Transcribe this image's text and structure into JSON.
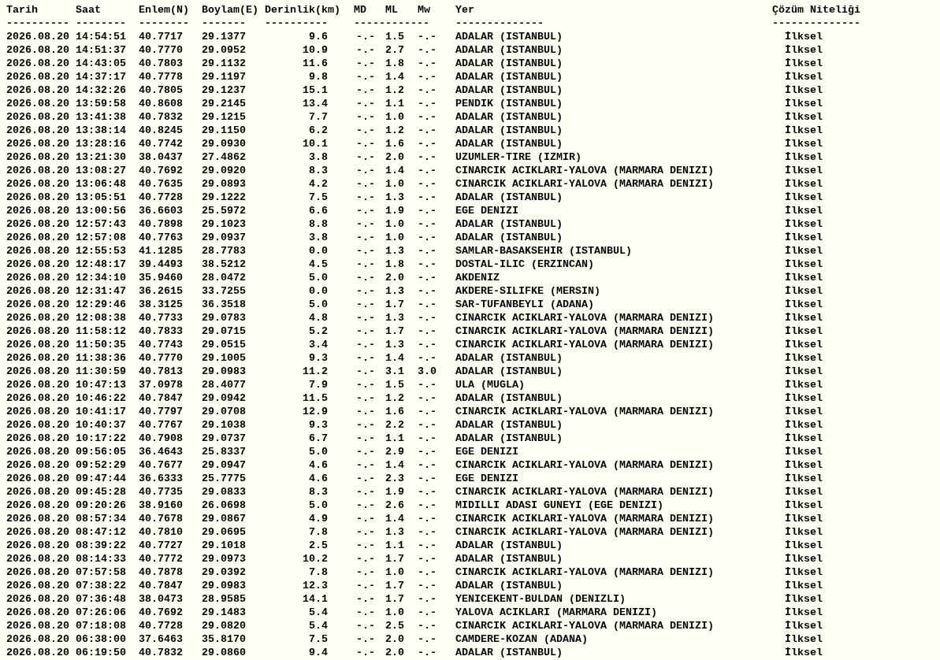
{
  "table": {
    "columns": [
      "Tarih",
      "Saat",
      "Enlem(N)",
      "Boylam(E)",
      "Derinlik(km)",
      "MD",
      "ML",
      "Mw",
      "Yer",
      "Çözüm Niteliği"
    ],
    "separators": [
      "----------",
      "--------",
      "--------",
      "-------",
      "----------",
      "------------",
      "--------------",
      "--------------"
    ],
    "rows": [
      {
        "date": "2026.08.20",
        "time": "14:54:51",
        "lat": "40.7717",
        "lon": "29.1377",
        "depth": "9.6",
        "md": "-.-",
        "ml": "1.5",
        "mw": "-.-",
        "place": "ADALAR (ISTANBUL)",
        "quality": "İlksel"
      },
      {
        "date": "2026.08.20",
        "time": "14:51:37",
        "lat": "40.7770",
        "lon": "29.0952",
        "depth": "10.9",
        "md": "-.-",
        "ml": "2.7",
        "mw": "-.-",
        "place": "ADALAR (ISTANBUL)",
        "quality": "İlksel"
      },
      {
        "date": "2026.08.20",
        "time": "14:43:05",
        "lat": "40.7803",
        "lon": "29.1132",
        "depth": "11.6",
        "md": "-.-",
        "ml": "1.8",
        "mw": "-.-",
        "place": "ADALAR (ISTANBUL)",
        "quality": "İlksel"
      },
      {
        "date": "2026.08.20",
        "time": "14:37:17",
        "lat": "40.7778",
        "lon": "29.1197",
        "depth": "9.8",
        "md": "-.-",
        "ml": "1.4",
        "mw": "-.-",
        "place": "ADALAR (ISTANBUL)",
        "quality": "İlksel"
      },
      {
        "date": "2026.08.20",
        "time": "14:32:26",
        "lat": "40.7805",
        "lon": "29.1237",
        "depth": "15.1",
        "md": "-.-",
        "ml": "1.2",
        "mw": "-.-",
        "place": "ADALAR (ISTANBUL)",
        "quality": "İlksel"
      },
      {
        "date": "2026.08.20",
        "time": "13:59:58",
        "lat": "40.8608",
        "lon": "29.2145",
        "depth": "13.4",
        "md": "-.-",
        "ml": "1.1",
        "mw": "-.-",
        "place": "PENDIK (ISTANBUL)",
        "quality": "İlksel"
      },
      {
        "date": "2026.08.20",
        "time": "13:41:38",
        "lat": "40.7832",
        "lon": "29.1215",
        "depth": "7.7",
        "md": "-.-",
        "ml": "1.0",
        "mw": "-.-",
        "place": "ADALAR (ISTANBUL)",
        "quality": "İlksel"
      },
      {
        "date": "2026.08.20",
        "time": "13:38:14",
        "lat": "40.8245",
        "lon": "29.1150",
        "depth": "6.2",
        "md": "-.-",
        "ml": "1.2",
        "mw": "-.-",
        "place": "ADALAR (ISTANBUL)",
        "quality": "İlksel"
      },
      {
        "date": "2026.08.20",
        "time": "13:28:16",
        "lat": "40.7742",
        "lon": "29.0930",
        "depth": "10.1",
        "md": "-.-",
        "ml": "1.6",
        "mw": "-.-",
        "place": "ADALAR (ISTANBUL)",
        "quality": "İlksel"
      },
      {
        "date": "2026.08.20",
        "time": "13:21:30",
        "lat": "38.0437",
        "lon": "27.4862",
        "depth": "3.8",
        "md": "-.-",
        "ml": "2.0",
        "mw": "-.-",
        "place": "UZUMLER-TIRE (IZMIR)",
        "quality": "İlksel"
      },
      {
        "date": "2026.08.20",
        "time": "13:08:27",
        "lat": "40.7692",
        "lon": "29.0920",
        "depth": "8.3",
        "md": "-.-",
        "ml": "1.4",
        "mw": "-.-",
        "place": "CINARCIK ACIKLARI-YALOVA (MARMARA DENIZI)",
        "quality": "İlksel"
      },
      {
        "date": "2026.08.20",
        "time": "13:06:48",
        "lat": "40.7635",
        "lon": "29.0893",
        "depth": "4.2",
        "md": "-.-",
        "ml": "1.0",
        "mw": "-.-",
        "place": "CINARCIK ACIKLARI-YALOVA (MARMARA DENIZI)",
        "quality": "İlksel"
      },
      {
        "date": "2026.08.20",
        "time": "13:05:51",
        "lat": "40.7728",
        "lon": "29.1222",
        "depth": "7.5",
        "md": "-.-",
        "ml": "1.3",
        "mw": "-.-",
        "place": "ADALAR (ISTANBUL)",
        "quality": "İlksel"
      },
      {
        "date": "2026.08.20",
        "time": "13:00:56",
        "lat": "36.6603",
        "lon": "25.5972",
        "depth": "6.6",
        "md": "-.-",
        "ml": "1.9",
        "mw": "-.-",
        "place": "EGE DENIZI",
        "quality": "İlksel"
      },
      {
        "date": "2026.08.20",
        "time": "12:57:43",
        "lat": "40.7898",
        "lon": "29.1023",
        "depth": "8.8",
        "md": "-.-",
        "ml": "1.0",
        "mw": "-.-",
        "place": "ADALAR (ISTANBUL)",
        "quality": "İlksel"
      },
      {
        "date": "2026.08.20",
        "time": "12:57:08",
        "lat": "40.7763",
        "lon": "29.0937",
        "depth": "3.8",
        "md": "-.-",
        "ml": "1.0",
        "mw": "-.-",
        "place": "ADALAR (ISTANBUL)",
        "quality": "İlksel"
      },
      {
        "date": "2026.08.20",
        "time": "12:55:53",
        "lat": "41.1285",
        "lon": "28.7783",
        "depth": "0.0",
        "md": "-.-",
        "ml": "1.3",
        "mw": "-.-",
        "place": "SAMLAR-BASAKSEHIR (ISTANBUL)",
        "quality": "İlksel"
      },
      {
        "date": "2026.08.20",
        "time": "12:48:17",
        "lat": "39.4493",
        "lon": "38.5212",
        "depth": "4.5",
        "md": "-.-",
        "ml": "1.8",
        "mw": "-.-",
        "place": "DOSTAL-ILIC (ERZINCAN)",
        "quality": "İlksel"
      },
      {
        "date": "2026.08.20",
        "time": "12:34:10",
        "lat": "35.9460",
        "lon": "28.0472",
        "depth": "5.0",
        "md": "-.-",
        "ml": "2.0",
        "mw": "-.-",
        "place": "AKDENIZ",
        "quality": "İlksel"
      },
      {
        "date": "2026.08.20",
        "time": "12:31:47",
        "lat": "36.2615",
        "lon": "33.7255",
        "depth": "0.0",
        "md": "-.-",
        "ml": "1.3",
        "mw": "-.-",
        "place": "AKDERE-SILIFKE (MERSIN)",
        "quality": "İlksel"
      },
      {
        "date": "2026.08.20",
        "time": "12:29:46",
        "lat": "38.3125",
        "lon": "36.3518",
        "depth": "5.0",
        "md": "-.-",
        "ml": "1.7",
        "mw": "-.-",
        "place": "SAR-TUFANBEYLI (ADANA)",
        "quality": "İlksel"
      },
      {
        "date": "2026.08.20",
        "time": "12:08:38",
        "lat": "40.7733",
        "lon": "29.0783",
        "depth": "4.8",
        "md": "-.-",
        "ml": "1.3",
        "mw": "-.-",
        "place": "CINARCIK ACIKLARI-YALOVA (MARMARA DENIZI)",
        "quality": "İlksel"
      },
      {
        "date": "2026.08.20",
        "time": "11:58:12",
        "lat": "40.7833",
        "lon": "29.0715",
        "depth": "5.2",
        "md": "-.-",
        "ml": "1.7",
        "mw": "-.-",
        "place": "CINARCIK ACIKLARI-YALOVA (MARMARA DENIZI)",
        "quality": "İlksel"
      },
      {
        "date": "2026.08.20",
        "time": "11:50:35",
        "lat": "40.7743",
        "lon": "29.0515",
        "depth": "3.4",
        "md": "-.-",
        "ml": "1.3",
        "mw": "-.-",
        "place": "CINARCIK ACIKLARI-YALOVA (MARMARA DENIZI)",
        "quality": "İlksel"
      },
      {
        "date": "2026.08.20",
        "time": "11:38:36",
        "lat": "40.7770",
        "lon": "29.1005",
        "depth": "9.3",
        "md": "-.-",
        "ml": "1.4",
        "mw": "-.-",
        "place": "ADALAR (ISTANBUL)",
        "quality": "İlksel"
      },
      {
        "date": "2026.08.20",
        "time": "11:30:59",
        "lat": "40.7813",
        "lon": "29.0983",
        "depth": "11.2",
        "md": "-.-",
        "ml": "3.1",
        "mw": "3.0",
        "place": "ADALAR (ISTANBUL)",
        "quality": "İlksel"
      },
      {
        "date": "2026.08.20",
        "time": "10:47:13",
        "lat": "37.0978",
        "lon": "28.4077",
        "depth": "7.9",
        "md": "-.-",
        "ml": "1.5",
        "mw": "-.-",
        "place": "ULA (MUGLA)",
        "quality": "İlksel"
      },
      {
        "date": "2026.08.20",
        "time": "10:46:22",
        "lat": "40.7847",
        "lon": "29.0942",
        "depth": "11.5",
        "md": "-.-",
        "ml": "1.2",
        "mw": "-.-",
        "place": "ADALAR (ISTANBUL)",
        "quality": "İlksel"
      },
      {
        "date": "2026.08.20",
        "time": "10:41:17",
        "lat": "40.7797",
        "lon": "29.0708",
        "depth": "12.9",
        "md": "-.-",
        "ml": "1.6",
        "mw": "-.-",
        "place": "CINARCIK ACIKLARI-YALOVA (MARMARA DENIZI)",
        "quality": "İlksel"
      },
      {
        "date": "2026.08.20",
        "time": "10:40:37",
        "lat": "40.7767",
        "lon": "29.1038",
        "depth": "9.3",
        "md": "-.-",
        "ml": "2.2",
        "mw": "-.-",
        "place": "ADALAR (ISTANBUL)",
        "quality": "İlksel"
      },
      {
        "date": "2026.08.20",
        "time": "10:17:22",
        "lat": "40.7908",
        "lon": "29.0737",
        "depth": "6.7",
        "md": "-.-",
        "ml": "1.1",
        "mw": "-.-",
        "place": "ADALAR (ISTANBUL)",
        "quality": "İlksel"
      },
      {
        "date": "2026.08.20",
        "time": "09:56:05",
        "lat": "36.4643",
        "lon": "25.8337",
        "depth": "5.0",
        "md": "-.-",
        "ml": "2.9",
        "mw": "-.-",
        "place": "EGE DENIZI",
        "quality": "İlksel"
      },
      {
        "date": "2026.08.20",
        "time": "09:52:29",
        "lat": "40.7677",
        "lon": "29.0947",
        "depth": "4.6",
        "md": "-.-",
        "ml": "1.4",
        "mw": "-.-",
        "place": "CINARCIK ACIKLARI-YALOVA (MARMARA DENIZI)",
        "quality": "İlksel"
      },
      {
        "date": "2026.08.20",
        "time": "09:47:44",
        "lat": "36.6333",
        "lon": "25.7775",
        "depth": "4.6",
        "md": "-.-",
        "ml": "2.3",
        "mw": "-.-",
        "place": "EGE DENIZI",
        "quality": "İlksel"
      },
      {
        "date": "2026.08.20",
        "time": "09:45:28",
        "lat": "40.7735",
        "lon": "29.0833",
        "depth": "8.3",
        "md": "-.-",
        "ml": "1.9",
        "mw": "-.-",
        "place": "CINARCIK ACIKLARI-YALOVA (MARMARA DENIZI)",
        "quality": "İlksel"
      },
      {
        "date": "2026.08.20",
        "time": "09:20:26",
        "lat": "38.9160",
        "lon": "26.0698",
        "depth": "5.0",
        "md": "-.-",
        "ml": "2.6",
        "mw": "-.-",
        "place": "MIDILLI ADASI GUNEYI (EGE DENIZI)",
        "quality": "İlksel"
      },
      {
        "date": "2026.08.20",
        "time": "08:57:34",
        "lat": "40.7678",
        "lon": "29.0867",
        "depth": "4.9",
        "md": "-.-",
        "ml": "1.4",
        "mw": "-.-",
        "place": "CINARCIK ACIKLARI-YALOVA (MARMARA DENIZI)",
        "quality": "İlksel"
      },
      {
        "date": "2026.08.20",
        "time": "08:47:12",
        "lat": "40.7810",
        "lon": "29.0695",
        "depth": "7.8",
        "md": "-.-",
        "ml": "1.3",
        "mw": "-.-",
        "place": "CINARCIK ACIKLARI-YALOVA (MARMARA DENIZI)",
        "quality": "İlksel"
      },
      {
        "date": "2026.08.20",
        "time": "08:39:22",
        "lat": "40.7727",
        "lon": "29.1018",
        "depth": "2.5",
        "md": "-.-",
        "ml": "1.1",
        "mw": "-.-",
        "place": "ADALAR (ISTANBUL)",
        "quality": "İlksel"
      },
      {
        "date": "2026.08.20",
        "time": "08:14:33",
        "lat": "40.7772",
        "lon": "29.0973",
        "depth": "10.2",
        "md": "-.-",
        "ml": "1.7",
        "mw": "-.-",
        "place": "ADALAR (ISTANBUL)",
        "quality": "İlksel"
      },
      {
        "date": "2026.08.20",
        "time": "07:57:58",
        "lat": "40.7878",
        "lon": "29.0392",
        "depth": "7.8",
        "md": "-.-",
        "ml": "1.0",
        "mw": "-.-",
        "place": "CINARCIK ACIKLARI-YALOVA (MARMARA DENIZI)",
        "quality": "İlksel"
      },
      {
        "date": "2026.08.20",
        "time": "07:38:22",
        "lat": "40.7847",
        "lon": "29.0983",
        "depth": "12.3",
        "md": "-.-",
        "ml": "1.7",
        "mw": "-.-",
        "place": "ADALAR (ISTANBUL)",
        "quality": "İlksel"
      },
      {
        "date": "2026.08.20",
        "time": "07:36:48",
        "lat": "38.0473",
        "lon": "28.9585",
        "depth": "14.1",
        "md": "-.-",
        "ml": "1.7",
        "mw": "-.-",
        "place": "YENICEKENT-BULDAN (DENIZLI)",
        "quality": "İlksel"
      },
      {
        "date": "2026.08.20",
        "time": "07:26:06",
        "lat": "40.7692",
        "lon": "29.1483",
        "depth": "5.4",
        "md": "-.-",
        "ml": "1.0",
        "mw": "-.-",
        "place": "YALOVA ACIKLARI (MARMARA DENIZI)",
        "quality": "İlksel"
      },
      {
        "date": "2026.08.20",
        "time": "07:18:08",
        "lat": "40.7728",
        "lon": "29.0820",
        "depth": "5.4",
        "md": "-.-",
        "ml": "2.5",
        "mw": "-.-",
        "place": "CINARCIK ACIKLARI-YALOVA (MARMARA DENIZI)",
        "quality": "İlksel"
      },
      {
        "date": "2026.08.20",
        "time": "06:38:00",
        "lat": "37.6463",
        "lon": "35.8170",
        "depth": "7.5",
        "md": "-.-",
        "ml": "2.0",
        "mw": "-.-",
        "place": "CAMDERE-KOZAN (ADANA)",
        "quality": "İlksel"
      },
      {
        "date": "2026.08.20",
        "time": "06:19:50",
        "lat": "40.7832",
        "lon": "29.0860",
        "depth": "9.4",
        "md": "-.-",
        "ml": "2.0",
        "mw": "-.-",
        "place": "ADALAR (ISTANBUL)",
        "quality": "İlksel"
      }
    ]
  }
}
